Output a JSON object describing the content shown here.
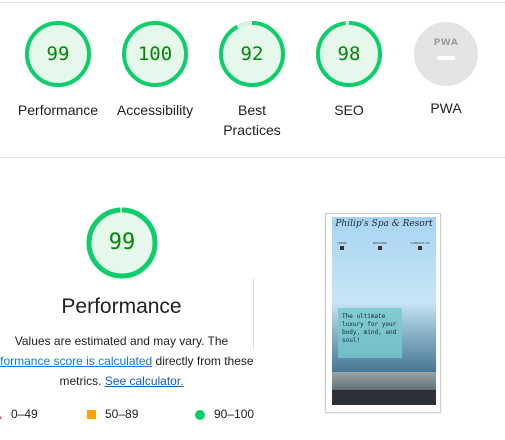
{
  "summary": {
    "gauges": [
      {
        "score": "99",
        "title": "Performance",
        "value": 99
      },
      {
        "score": "100",
        "title": "Accessibility",
        "value": 100
      },
      {
        "score": "92",
        "title": "Best Practices",
        "value": 92
      },
      {
        "score": "98",
        "title": "SEO",
        "value": 98
      }
    ],
    "pwa": {
      "badge_text": "PWA",
      "title": "PWA"
    }
  },
  "performance": {
    "score": "99",
    "value": 99,
    "title": "Performance",
    "desc_line1": "Values are estimated and may vary. The",
    "desc_link": "erformance score is calculated",
    "desc_line2_rest": " directly from these",
    "desc_line3_pre": "metrics. ",
    "calc_link": "See calculator."
  },
  "legend": {
    "fail": "0–49",
    "average": "50–89",
    "pass": "90–100"
  },
  "screenshot": {
    "site_title": "Philip's Spa & Resort",
    "nav": [
      "HOME",
      "BOOKING",
      "CONTACT US"
    ],
    "card_text": "The ultimate luxury for your body, mind, and soul!"
  },
  "colors": {
    "pass": "#0cce6b",
    "pass_text": "#008800",
    "average": "#ffa400",
    "fail": "#ff4e42",
    "link": "#1a73e8"
  }
}
